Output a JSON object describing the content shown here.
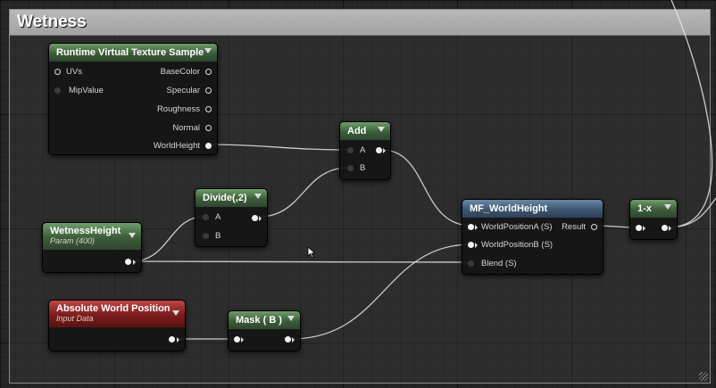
{
  "comment": {
    "title": "Wetness"
  },
  "nodes": {
    "rvt": {
      "title": "Runtime Virtual Texture Sample",
      "inputs": [
        "UVs",
        "MipValue"
      ],
      "outputs": [
        "BaseColor",
        "Specular",
        "Roughness",
        "Normal",
        "WorldHeight"
      ]
    },
    "add": {
      "title": "Add",
      "inputs": [
        "A",
        "B"
      ]
    },
    "divide": {
      "title": "Divide(,2)",
      "inputs": [
        "A",
        "B"
      ]
    },
    "wetness_height": {
      "title": "WetnessHeight",
      "subtitle": "Param (400)"
    },
    "mf_world_height": {
      "title": "MF_WorldHeight",
      "inputs": [
        "WorldPositionA (S)",
        "WorldPositionB (S)",
        "Blend (S)"
      ],
      "outputs": [
        "Result"
      ]
    },
    "one_minus": {
      "title": "1-x"
    },
    "abs_world_pos": {
      "title": "Absolute World Position",
      "subtitle": "Input Data"
    },
    "mask": {
      "title": "Mask ( B )"
    }
  },
  "colors": {
    "header_green": "#4d7a49",
    "header_gray": "#474747",
    "header_blue": "#4e6a86",
    "header_red": "#8f2424",
    "wire": "#e8e8e8",
    "comment_header": "#aeaeae"
  },
  "icons": [
    "collapse-arrow-icon",
    "pin-icon",
    "cursor-icon",
    "resize-grip-icon"
  ]
}
